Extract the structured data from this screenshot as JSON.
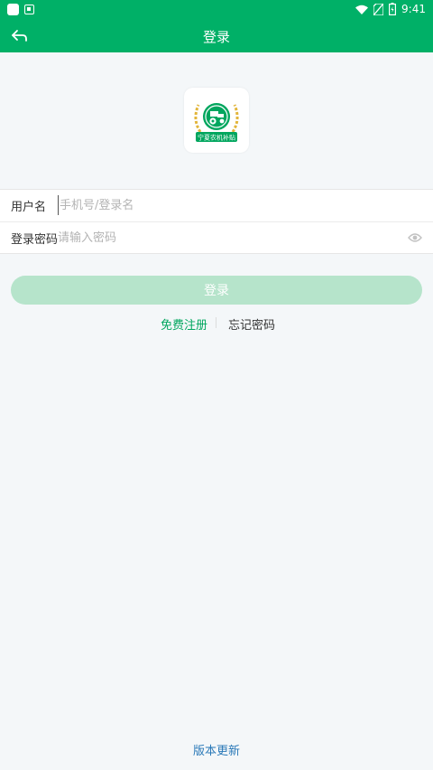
{
  "status_bar": {
    "time": "9:41"
  },
  "app_bar": {
    "title": "登录"
  },
  "logo": {
    "text": "宁夏农机补贴"
  },
  "form": {
    "username": {
      "label": "用户名",
      "placeholder": "手机号/登录名",
      "value": ""
    },
    "password": {
      "label": "登录密码",
      "placeholder": "请输入密码",
      "value": ""
    }
  },
  "buttons": {
    "login_label": "登录"
  },
  "links": {
    "register": "免费注册",
    "forgot": "忘记密码"
  },
  "footer": {
    "update": "版本更新"
  },
  "colors": {
    "brand": "#00b067",
    "login_disabled": "#b6e4cb",
    "link_green": "#00a65e",
    "link_blue": "#2a79b8"
  }
}
